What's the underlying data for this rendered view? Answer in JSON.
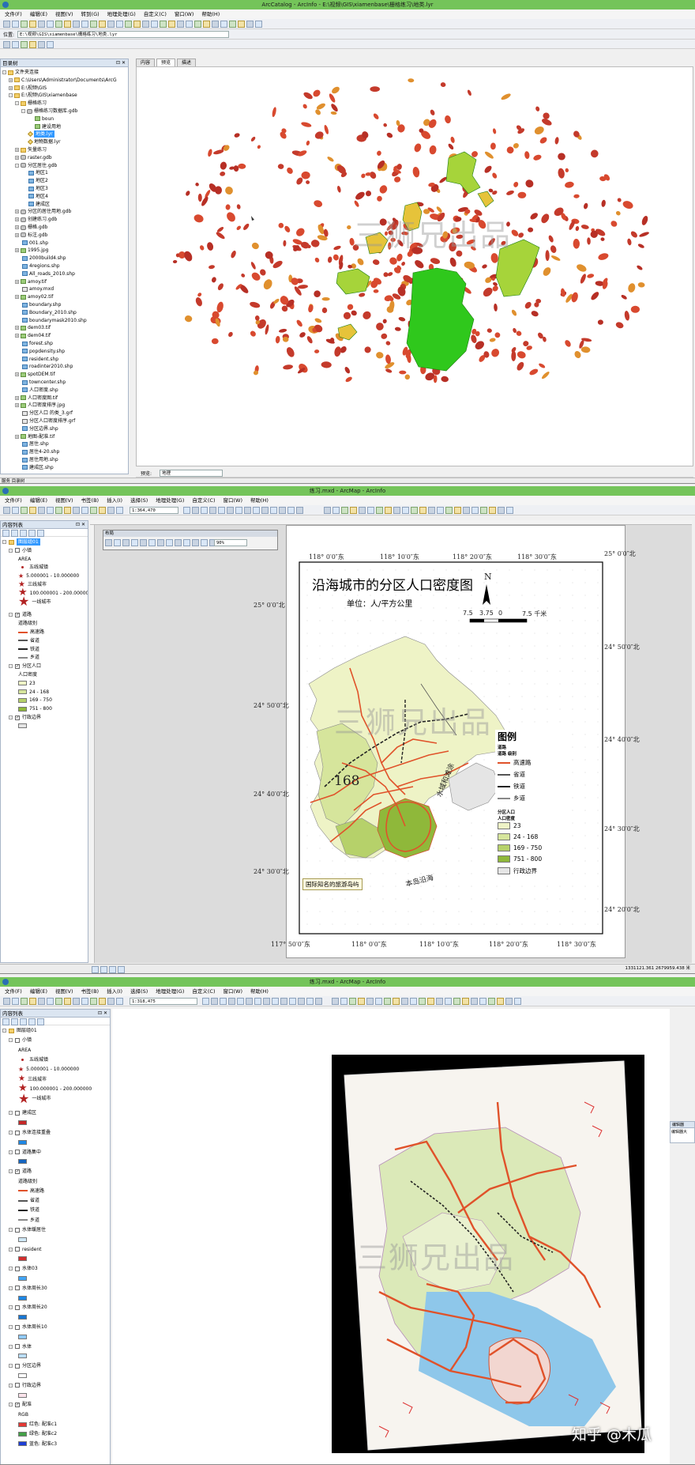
{
  "win1": {
    "title": "ArcCatalog - ArcInfo - E:\\视频\\GIS\\xiamenbase\\栅格练习\\地类.lyr",
    "menu": [
      "文件(F)",
      "编辑(E)",
      "视图(V)",
      "转到(G)",
      "地理处理(G)",
      "自定义(C)",
      "窗口(W)",
      "帮助(H)"
    ],
    "location_label": "位置:",
    "location_value": "E:\\视频\\GIS\\xiamenbase\\栅格练习\\地类.lyr",
    "catalog_title": "目录树",
    "tabs": [
      "内容",
      "预览",
      "描述"
    ],
    "active_tab": "预览",
    "preview_label": "预览:",
    "preview_value": "地理",
    "tree": [
      {
        "label": "文件夹连接",
        "level": 0,
        "icon": "folder",
        "toggle": "-"
      },
      {
        "label": "C:\\Users\\Administrator\\Documents\\ArcG",
        "level": 1,
        "icon": "folder",
        "toggle": "+"
      },
      {
        "label": "E:\\视频\\GIS",
        "level": 1,
        "icon": "folder",
        "toggle": "+"
      },
      {
        "label": "E:\\视频\\GIS\\xiamenbase",
        "level": 1,
        "icon": "folder",
        "toggle": "-"
      },
      {
        "label": "栅格练习",
        "level": 2,
        "icon": "folder",
        "toggle": "-"
      },
      {
        "label": "栅格练习数据库.gdb",
        "level": 3,
        "icon": "gdb",
        "toggle": "-"
      },
      {
        "label": "boun",
        "level": 4,
        "icon": "raster",
        "toggle": ""
      },
      {
        "label": "建设用地",
        "level": 4,
        "icon": "raster",
        "toggle": ""
      },
      {
        "label": "地类.lyr",
        "level": 3,
        "icon": "lyr",
        "toggle": "",
        "selected": true
      },
      {
        "label": "地物数据.lyr",
        "level": 3,
        "icon": "lyr",
        "toggle": ""
      },
      {
        "label": "矢量练习",
        "level": 2,
        "icon": "folder",
        "toggle": "+"
      },
      {
        "label": "raster.gdb",
        "level": 2,
        "icon": "gdb",
        "toggle": "+"
      },
      {
        "label": "分区居住.gdb",
        "level": 2,
        "icon": "gdb",
        "toggle": "-"
      },
      {
        "label": "地区1",
        "level": 3,
        "icon": "shp",
        "toggle": ""
      },
      {
        "label": "地区2",
        "level": 3,
        "icon": "shp",
        "toggle": ""
      },
      {
        "label": "地区3",
        "level": 3,
        "icon": "shp",
        "toggle": ""
      },
      {
        "label": "地区4",
        "level": 3,
        "icon": "shp",
        "toggle": ""
      },
      {
        "label": "建成区",
        "level": 3,
        "icon": "shp",
        "toggle": ""
      },
      {
        "label": "分区的居住用地.gdb",
        "level": 2,
        "icon": "gdb",
        "toggle": "+"
      },
      {
        "label": "创建练习.gdb",
        "level": 2,
        "icon": "gdb",
        "toggle": "+"
      },
      {
        "label": "栅格.gdb",
        "level": 2,
        "icon": "gdb",
        "toggle": "+"
      },
      {
        "label": "标注.gdb",
        "level": 2,
        "icon": "gdb",
        "toggle": "+"
      },
      {
        "label": "001.shp",
        "level": 2,
        "icon": "shp",
        "toggle": ""
      },
      {
        "label": "1995.jpg",
        "level": 2,
        "icon": "raster",
        "toggle": "+"
      },
      {
        "label": "2000build4.shp",
        "level": 2,
        "icon": "shp",
        "toggle": ""
      },
      {
        "label": "4regions.shp",
        "level": 2,
        "icon": "shp",
        "toggle": ""
      },
      {
        "label": "All_roads_2010.shp",
        "level": 2,
        "icon": "shp",
        "toggle": ""
      },
      {
        "label": "amoy.tif",
        "level": 2,
        "icon": "raster",
        "toggle": "+"
      },
      {
        "label": "amoy.mxd",
        "level": 2,
        "icon": "mxd",
        "toggle": ""
      },
      {
        "label": "amoy02.tif",
        "level": 2,
        "icon": "raster",
        "toggle": "+"
      },
      {
        "label": "boundary.shp",
        "level": 2,
        "icon": "shp",
        "toggle": ""
      },
      {
        "label": "Boundary_2010.shp",
        "level": 2,
        "icon": "shp",
        "toggle": ""
      },
      {
        "label": "boundarymask2010.shp",
        "level": 2,
        "icon": "shp",
        "toggle": ""
      },
      {
        "label": "dem03.tif",
        "level": 2,
        "icon": "raster",
        "toggle": "+"
      },
      {
        "label": "dem04.tif",
        "level": 2,
        "icon": "raster",
        "toggle": "+"
      },
      {
        "label": "forest.shp",
        "level": 2,
        "icon": "shp",
        "toggle": ""
      },
      {
        "label": "popdensity.shp",
        "level": 2,
        "icon": "shp",
        "toggle": ""
      },
      {
        "label": "resident.shp",
        "level": 2,
        "icon": "shp",
        "toggle": ""
      },
      {
        "label": "roadinter2010.shp",
        "level": 2,
        "icon": "shp",
        "toggle": ""
      },
      {
        "label": "spotDEM.tif",
        "level": 2,
        "icon": "raster",
        "toggle": "+"
      },
      {
        "label": "towncenter.shp",
        "level": 2,
        "icon": "shp",
        "toggle": ""
      },
      {
        "label": "人口密度.shp",
        "level": 2,
        "icon": "shp",
        "toggle": ""
      },
      {
        "label": "人口密度图.tif",
        "level": 2,
        "icon": "raster",
        "toggle": "+"
      },
      {
        "label": "人口密度排序.jpg",
        "level": 2,
        "icon": "raster",
        "toggle": "+"
      },
      {
        "label": "分区人口 的类_3.grf",
        "level": 2,
        "icon": "mxd",
        "toggle": ""
      },
      {
        "label": "分区人口密度排序.grf",
        "level": 2,
        "icon": "mxd",
        "toggle": ""
      },
      {
        "label": "分区边界.shp",
        "level": 2,
        "icon": "shp",
        "toggle": ""
      },
      {
        "label": "地图-配准.tif",
        "level": 2,
        "icon": "raster",
        "toggle": "+"
      },
      {
        "label": "居住.shp",
        "level": 2,
        "icon": "shp",
        "toggle": ""
      },
      {
        "label": "居住4-20.shp",
        "level": 2,
        "icon": "shp",
        "toggle": ""
      },
      {
        "label": "居住用地.shp",
        "level": 2,
        "icon": "shp",
        "toggle": ""
      },
      {
        "label": "建成区.shp",
        "level": 2,
        "icon": "shp",
        "toggle": ""
      }
    ],
    "status_left": "服务 目录树"
  },
  "win2": {
    "title": "练习.mxd - ArcMap - ArcInfo",
    "menu": [
      "文件(F)",
      "编辑(E)",
      "视图(V)",
      "书签(B)",
      "插入(I)",
      "选择(S)",
      "地理处理(G)",
      "自定义(C)",
      "窗口(W)",
      "帮助(H)"
    ],
    "scale": "1:364,470",
    "toc_title": "内容列表",
    "layout_toolbar_title": "布局",
    "zoom_value": "90%",
    "toc": [
      {
        "type": "group",
        "label": "图层组01",
        "selected": true
      },
      {
        "type": "layer",
        "label": "小镇",
        "checked": false
      },
      {
        "type": "text",
        "label": "AREA"
      },
      {
        "type": "point",
        "label": "五线城镇",
        "size": 3
      },
      {
        "type": "star",
        "label": "5.000001 - 10.000000",
        "size": 6
      },
      {
        "type": "star",
        "label": "三线城市",
        "size": 8
      },
      {
        "type": "star",
        "label": "100.000001 - 200.000000",
        "size": 11
      },
      {
        "type": "star",
        "label": "一线城市",
        "size": 14
      },
      {
        "type": "layer",
        "label": "道路",
        "checked": true
      },
      {
        "type": "text",
        "label": "道路级别"
      },
      {
        "type": "line",
        "label": "高速路",
        "color": "#e0522a"
      },
      {
        "type": "line",
        "label": "省道",
        "color": "#555555"
      },
      {
        "type": "line",
        "label": "铁道",
        "color": "#222222"
      },
      {
        "type": "line",
        "label": "乡道",
        "color": "#888888"
      },
      {
        "type": "layer",
        "label": "分区人口",
        "checked": true
      },
      {
        "type": "text",
        "label": "人口密度"
      },
      {
        "type": "swatch",
        "label": "23",
        "color": "#eef3c6"
      },
      {
        "type": "swatch",
        "label": "24 - 168",
        "color": "#d6e59c"
      },
      {
        "type": "swatch",
        "label": "169 - 750",
        "color": "#b6d16a"
      },
      {
        "type": "swatch",
        "label": "751 - 800",
        "color": "#8fb83a"
      },
      {
        "type": "layer",
        "label": "行政边界",
        "checked": true
      },
      {
        "type": "swatch",
        "label": "",
        "color": "#e5e5e5"
      }
    ],
    "map": {
      "title": "沿海城市的分区人口密度图",
      "unit": "单位：人/平方公里",
      "scalebar_labels": [
        "7.5",
        "3.75",
        "0",
        "7.5 千米"
      ],
      "north": "N",
      "top_lon": [
        "118° 0′0″东",
        "118° 10′0″东",
        "118° 20′0″东",
        "118° 30′0″东"
      ],
      "bottom_lon": [
        "117° 50′0″东",
        "118° 0′0″东",
        "118° 10′0″东",
        "118° 20′0″东",
        "118° 30′0″东"
      ],
      "left_lat": [
        "25° 0′0″北",
        "24° 50′0″北",
        "24° 40′0″北",
        "24° 30′0″北"
      ],
      "right_lat": [
        "25° 0′0″北",
        "24° 50′0″北",
        "24° 40′0″北",
        "24° 30′0″北",
        "24° 20′0″北"
      ],
      "label_168": "168",
      "water_label": "水域和滩涂",
      "island_label": "本岛沿海",
      "callout": "国际知名的旅游岛屿",
      "legend_title": "图例",
      "legend_road_group": "道路",
      "legend_road_field": "道路 级别",
      "legend_roads": [
        {
          "label": "高速路",
          "color": "#e0522a"
        },
        {
          "label": "省道",
          "color": "#555555"
        },
        {
          "label": "铁道",
          "color": "#222222"
        },
        {
          "label": "乡道",
          "color": "#888888"
        }
      ],
      "legend_pop_group": "分区人口",
      "legend_pop_field": "人口密度",
      "legend_pop": [
        {
          "label": "23",
          "color": "#eef3c6"
        },
        {
          "label": "24 - 168",
          "color": "#d6e59c"
        },
        {
          "label": "169 - 750",
          "color": "#b6d16a"
        },
        {
          "label": "751 - 800",
          "color": "#8fb83a"
        },
        {
          "label": "行政边界",
          "color": "#e5e5e5"
        }
      ]
    },
    "coords": "1331121.361  2679959.438 米"
  },
  "win3": {
    "title": "练习.mxd - ArcMap - ArcInfo",
    "menu": [
      "文件(F)",
      "编辑(E)",
      "视图(V)",
      "书签(B)",
      "插入(I)",
      "选择(S)",
      "地理处理(G)",
      "自定义(C)",
      "窗口(W)",
      "帮助(H)"
    ],
    "scale": "1:318,475",
    "toc_title": "内容列表",
    "side_panel_title": "编辑器",
    "side_panel_text": "编辑器大",
    "toc": [
      {
        "type": "group",
        "label": "图层组01",
        "selected": false
      },
      {
        "type": "layer",
        "label": "小镇",
        "checked": false
      },
      {
        "type": "text",
        "label": "AREA"
      },
      {
        "type": "point",
        "label": "五线城镇",
        "size": 3
      },
      {
        "type": "star",
        "label": "5.000001 - 10.000000",
        "size": 6
      },
      {
        "type": "star",
        "label": "三线城市",
        "size": 8
      },
      {
        "type": "star",
        "label": "100.000001 - 200.000000",
        "size": 11
      },
      {
        "type": "star",
        "label": "一线城市",
        "size": 14
      },
      {
        "type": "layer",
        "label": "建成区",
        "checked": false
      },
      {
        "type": "swatch",
        "label": "",
        "color": "#c62828"
      },
      {
        "type": "layer",
        "label": "水体连接重叠",
        "checked": false
      },
      {
        "type": "swatch",
        "label": "",
        "color": "#1e88e5"
      },
      {
        "type": "layer",
        "label": "道路集中",
        "checked": false
      },
      {
        "type": "swatch",
        "label": "",
        "color": "#1565c0"
      },
      {
        "type": "layer",
        "label": "道路",
        "checked": true
      },
      {
        "type": "text",
        "label": "道路级别"
      },
      {
        "type": "line",
        "label": "高速路",
        "color": "#e0522a"
      },
      {
        "type": "line",
        "label": "省道",
        "color": "#555555"
      },
      {
        "type": "line",
        "label": "铁道",
        "color": "#222222"
      },
      {
        "type": "line",
        "label": "乡道",
        "color": "#888888"
      },
      {
        "type": "layer",
        "label": "水体缓居住",
        "checked": false
      },
      {
        "type": "swatch",
        "label": "",
        "color": "#cfe8f7"
      },
      {
        "type": "layer",
        "label": "resident",
        "checked": false
      },
      {
        "type": "swatch",
        "label": "",
        "color": "#d32f2f"
      },
      {
        "type": "layer",
        "label": "水体03",
        "checked": false
      },
      {
        "type": "swatch",
        "label": "",
        "color": "#42a5f5"
      },
      {
        "type": "layer",
        "label": "水体周长30",
        "checked": false
      },
      {
        "type": "swatch",
        "label": "",
        "color": "#1e88e5"
      },
      {
        "type": "layer",
        "label": "水体周长20",
        "checked": false
      },
      {
        "type": "swatch",
        "label": "",
        "color": "#1976d2"
      },
      {
        "type": "layer",
        "label": "水体周长10",
        "checked": false
      },
      {
        "type": "swatch",
        "label": "",
        "color": "#90caf9"
      },
      {
        "type": "layer",
        "label": "水体",
        "checked": false
      },
      {
        "type": "swatch",
        "label": "",
        "color": "#bbdefb"
      },
      {
        "type": "layer",
        "label": "分区边界",
        "checked": false
      },
      {
        "type": "swatch",
        "label": "",
        "color": "#ffffff"
      },
      {
        "type": "layer",
        "label": "行政边界",
        "checked": false
      },
      {
        "type": "swatch",
        "label": "",
        "color": "#fce4ec"
      },
      {
        "type": "layer",
        "label": "配准",
        "checked": true
      },
      {
        "type": "text",
        "label": "RGB"
      },
      {
        "type": "swatch",
        "label": "红色: 配准c1",
        "color": "#e53935"
      },
      {
        "type": "swatch",
        "label": "绿色: 配准c2",
        "color": "#43a047"
      },
      {
        "type": "swatch",
        "label": "蓝色: 配准c3",
        "color": "#1e3fd6"
      }
    ],
    "signature": "知乎 @木瓜"
  },
  "watermark": "三狮兄出品"
}
